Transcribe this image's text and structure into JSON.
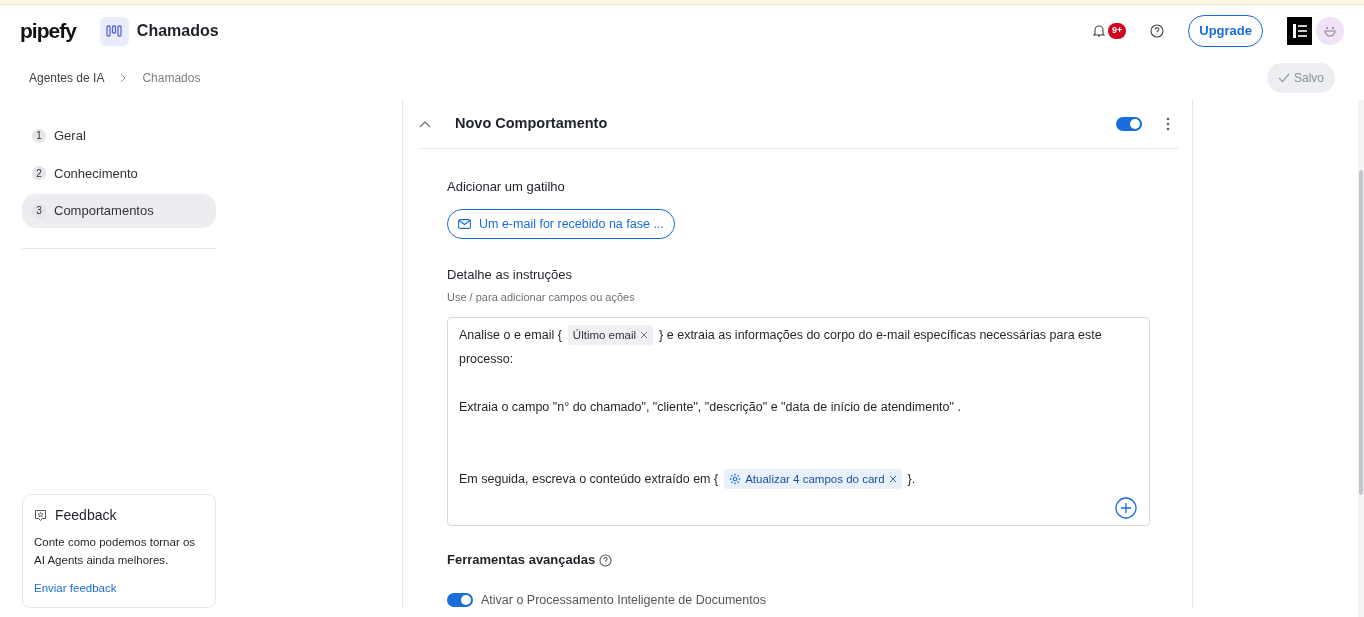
{
  "header": {
    "logo": "pipefy",
    "page_title": "Chamados",
    "notifications_badge": "9+",
    "upgrade_button": "Upgrade"
  },
  "breadcrumb": {
    "items": [
      "Agentes de IA",
      "Chamados"
    ],
    "save_status": "Salvo"
  },
  "sidebar": {
    "steps": [
      {
        "number": "1",
        "label": "Geral",
        "selected": false
      },
      {
        "number": "2",
        "label": "Conhecimento",
        "selected": false
      },
      {
        "number": "3",
        "label": "Comportamentos",
        "selected": true
      }
    ],
    "feedback": {
      "title": "Feedback",
      "text": "Conte como podemos tornar os AI Agents ainda melhores.",
      "link": "Enviar feedback"
    }
  },
  "behavior": {
    "title": "Novo Comportamento",
    "expanded": true,
    "enabled": true,
    "trigger": {
      "label": "Adicionar um gatilho",
      "value": "Um e-mail for recebido na fase ..."
    },
    "instructions": {
      "label": "Detalhe as instruções",
      "hint": "Use / para adicionar campos ou ações",
      "paragraphs": [
        [
          {
            "kind": "text",
            "text": "Analise o e email {"
          },
          {
            "kind": "field",
            "text": "Último email"
          },
          {
            "kind": "text",
            "text": "} e extraia as informações do corpo do e-mail específicas necessárias para este"
          },
          {
            "kind": "text",
            "text": "processo:"
          }
        ],
        [
          {
            "kind": "text",
            "text": "Extraia o campo \"n° do chamado\", \"cliente\", \"descrição\" e \"data de início de atendimento\" ."
          }
        ],
        [
          {
            "kind": "text",
            "text": "Em seguida, escreva o conteúdo extraído em {"
          },
          {
            "kind": "action",
            "text": "Atualizar 4 campos do card"
          },
          {
            "kind": "text",
            "text": "}."
          }
        ]
      ]
    },
    "advanced": {
      "title": "Ferramentas avançadas",
      "options": [
        {
          "label": "Ativar o Processamento Inteligente de Documentos",
          "on": true
        }
      ]
    }
  }
}
